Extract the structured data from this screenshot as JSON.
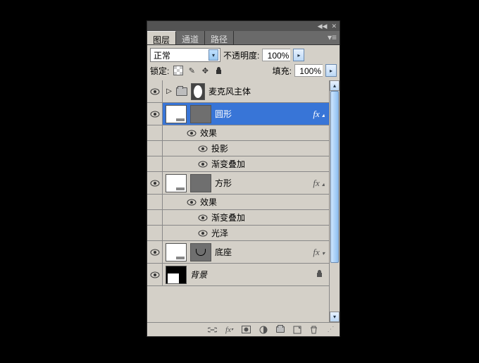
{
  "tabs": {
    "layers": "图层",
    "channels": "通道",
    "paths": "路径"
  },
  "blend_mode": "正常",
  "opacity": {
    "label": "不透明度:",
    "value": "100%"
  },
  "lock": {
    "label": "锁定:"
  },
  "fill": {
    "label": "填充:",
    "value": "100%"
  },
  "layers": [
    {
      "type": "group",
      "name": "麦克风主体"
    },
    {
      "type": "smart",
      "name": "圆形",
      "selected": true,
      "fx": true,
      "effects_label": "效果",
      "effects": [
        "投影",
        "渐变叠加"
      ]
    },
    {
      "type": "smart",
      "name": "方形",
      "fx": true,
      "effects_label": "效果",
      "effects": [
        "渐变叠加",
        "光泽"
      ]
    },
    {
      "type": "smart",
      "name": "底座",
      "fx": true,
      "shape": "smile"
    },
    {
      "type": "bg",
      "name": "背景",
      "locked": true
    }
  ],
  "fx_badge": "fx"
}
